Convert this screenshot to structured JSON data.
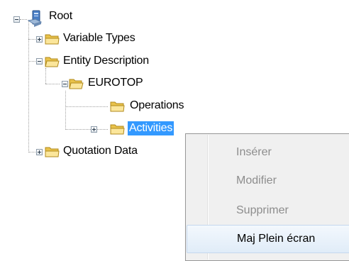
{
  "tree": {
    "root_label": "Root",
    "variable_types_label": "Variable Types",
    "entity_description_label": "Entity Description",
    "eurotop_label": "EUROTOP",
    "operations_label": "Operations",
    "activities_label": "Activities",
    "quotation_data_label": "Quotation Data"
  },
  "context_menu": {
    "insert_label": "Insérer",
    "modify_label": "Modifier",
    "delete_label": "Supprimer",
    "fullscreen_update_label": "Maj Plein écran"
  },
  "colors": {
    "selection": "#3399ff",
    "folder": "#f5d66a",
    "disabled_text": "#8d8d8d"
  },
  "icons": {
    "root": "computer-icon",
    "folder": "folder-icon",
    "expand": "plus-icon",
    "collapse": "minus-icon"
  }
}
